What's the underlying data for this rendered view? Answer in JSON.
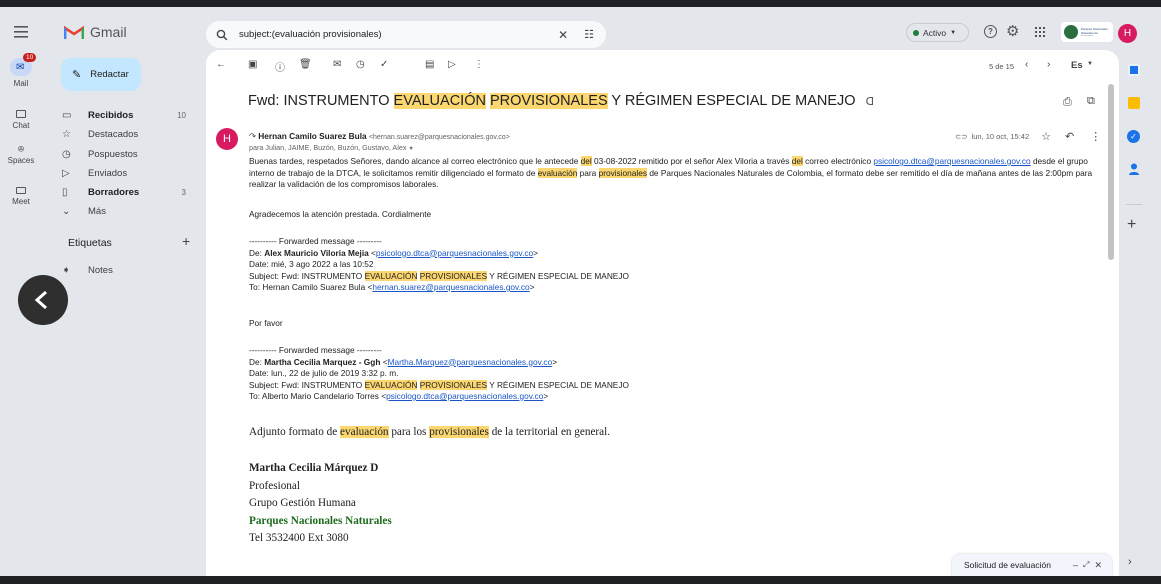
{
  "app": {
    "name": "Gmail"
  },
  "search": {
    "value": "subject:(evaluación provisionales)"
  },
  "header": {
    "status_label": "Activo",
    "org_logo_text": "Parques Nacionales Naturales de Colombia",
    "avatar_letter": "H"
  },
  "rail": [
    {
      "label": "Mail",
      "badge": "10"
    },
    {
      "label": "Chat"
    },
    {
      "label": "Spaces"
    },
    {
      "label": "Meet"
    }
  ],
  "compose": {
    "label": "Redactar"
  },
  "nav": [
    {
      "label": "Recibidos",
      "count": "10",
      "bold": true
    },
    {
      "label": "Destacados",
      "count": ""
    },
    {
      "label": "Pospuestos",
      "count": ""
    },
    {
      "label": "Enviados",
      "count": ""
    },
    {
      "label": "Borradores",
      "count": "3",
      "bold": true
    },
    {
      "label": "Más",
      "count": ""
    }
  ],
  "labels": {
    "title": "Etiquetas",
    "items": [
      {
        "label": "Notes"
      }
    ]
  },
  "toolbar": {
    "pagination": "5 de 15",
    "lang": "Es"
  },
  "email": {
    "subject_pre": "Fwd: INSTRUMENTO ",
    "subject_hl1": "EVALUACIÓN",
    "subject_hl2": "PROVISIONALES",
    "subject_post": " Y RÉGIMEN ESPECIAL DE MANEJO",
    "sender_letter": "H",
    "sender_name": "Hernan Camilo Suarez Bula",
    "sender_email": "<hernan.suarez@parquesnacionales.gov.co>",
    "recipients": "para Julian, JAIME, Buzón, Buzón, Gustavo, Alex",
    "date": "lun, 10 oct, 15:42",
    "p1": {
      "a": "Buenas tardes, respetados Señores, dando alcance al correo electrónico que le antecede ",
      "h1": "del",
      "b": " 03-08-2022 remitido por el señor Alex Viloria a través ",
      "h2": "del",
      "c": " correo electrónico ",
      "link": "psicologo.dtca@parquesnacionales.gov.co",
      "d": " desde el grupo interno de trabajo de la DTCA, le solicitamos remitir diligenciado el formato de ",
      "h3": "evaluación",
      "e": " para ",
      "h4": "provisionales",
      "f": " de Parques Nacionales Naturales de Colombia, el formato debe ser remitido el día de mañana antes de las 2:00pm para realizar la validación de los compromisos laborales."
    },
    "p2": "Agradecemos la atención prestada. Cordialmente",
    "fwd1": {
      "divider": "---------- Forwarded message ---------",
      "de_label": "De: ",
      "de_name": "Alex Mauricio Viloria Mejia",
      "de_email": "psicologo.dtca@parquesnacionales.gov.co",
      "date": "Date: mié, 3 ago 2022 a las 10:52",
      "subj_pre": "Subject: Fwd: INSTRUMENTO ",
      "subj_h1": "EVALUACIÓN",
      "subj_h2": "PROVISIONALES",
      "subj_post": " Y RÉGIMEN ESPECIAL DE MANEJO",
      "to_pre": "To: Hernan Camilo Suarez Bula ",
      "to_email": "hernan.suarez@parquesnacionales.gov.co"
    },
    "porfavor": "Por favor",
    "fwd2": {
      "divider": "---------- Forwarded message ---------",
      "de_label": "De: ",
      "de_name": "Martha Cecilia Marquez - Ggh",
      "de_email": "Martha.Marquez@parquesnacionales.gov.co",
      "date": "Date: lun., 22 de julio de 2019 3:32 p. m.",
      "subj_pre": "Subject: Fwd: INSTRUMENTO ",
      "subj_h1": "EVALUACIÓN",
      "subj_h2": "PROVISIONALES",
      "subj_post": " Y RÉGIMEN ESPECIAL DE MANEJO",
      "to_pre": "To: Alberto Mario Candelario Torres ",
      "to_email": "psicologo.dtca@parquesnacionales.gov.co"
    },
    "adj": {
      "a": "Adjunto formato de ",
      "h1": "evaluación",
      "b": " para los ",
      "h2": "provisionales",
      "c": " de la territorial en general."
    },
    "sig": {
      "name": "Martha Cecilia Márquez D",
      "role": "Profesional",
      "group": "Grupo Gestión Humana",
      "org": "Parques Nacionales Naturales",
      "tel": "Tel 3532400 Ext 3080"
    }
  },
  "draft": {
    "title": "Solicitud de evaluación"
  },
  "colors": {
    "accent": "#0b57d0",
    "highlight": "#fcd770",
    "avatar": "#d81b60",
    "org_green": "#1e6b1e"
  }
}
